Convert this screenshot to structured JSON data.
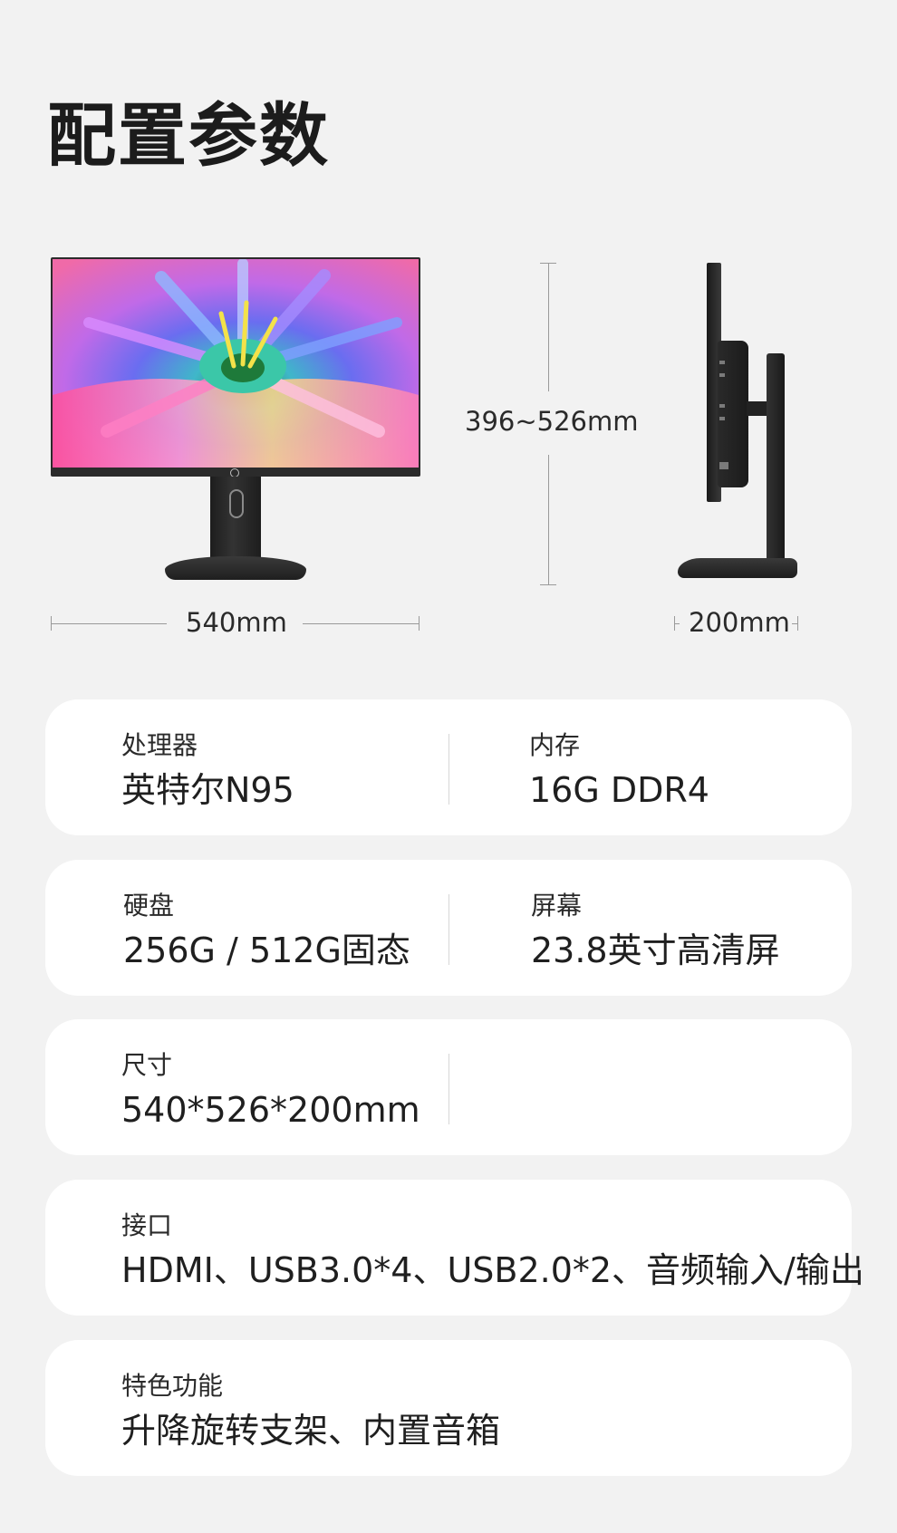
{
  "page": {
    "title": "配置参数"
  },
  "dimensions": {
    "width": "540mm",
    "height": "396~526mm",
    "depth": "200mm"
  },
  "specs": [
    {
      "cells": [
        {
          "label": "处理器",
          "value": "英特尔N95"
        },
        {
          "label": "内存",
          "value": "16G DDR4"
        }
      ]
    },
    {
      "cells": [
        {
          "label": "硬盘",
          "value": "256G / 512G固态"
        },
        {
          "label": "屏幕",
          "value": "23.8英寸高清屏"
        }
      ]
    },
    {
      "cells": [
        {
          "label": "尺寸",
          "value": "540*526*200mm"
        }
      ]
    },
    {
      "cells": [
        {
          "label": "接口",
          "value": "HDMI、USB3.0*4、USB2.0*2、音频输入/输出"
        }
      ]
    },
    {
      "cells": [
        {
          "label": "特色功能",
          "value": "升降旋转支架、内置音箱"
        }
      ]
    }
  ]
}
